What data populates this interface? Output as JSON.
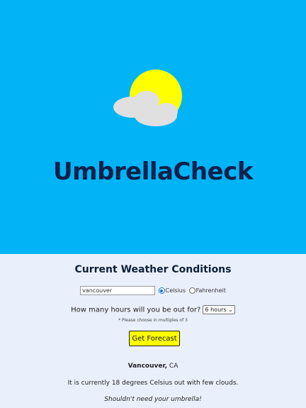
{
  "app": {
    "title": "UmbrellaCheck"
  },
  "colors": {
    "hero_bg": "#00b4f5",
    "content_bg": "#eaf0fb",
    "title_color": "#0d1f4a",
    "sun": "#ffff00",
    "cloud": "#e0e0e0",
    "button_bg": "#ffff00"
  },
  "logo": {
    "icon": "sun-behind-cloud-icon"
  },
  "section": {
    "title": "Current Weather Conditions"
  },
  "form": {
    "city_value": "vancouver",
    "unit_options": [
      "Celsius",
      "Fahrenheit"
    ],
    "unit_selected": "Celsius",
    "hours_label": "How many hours will you be out for?",
    "hours_selected": "6 hours",
    "hint": "* Please choose in multiples of 3",
    "submit_label": "Get Forecast"
  },
  "result": {
    "city": "Vancouver,",
    "country": "CA",
    "conditions": "It is currently 18 degrees Celsius out with few clouds.",
    "advice": "Shouldn't need your umbrella!"
  }
}
